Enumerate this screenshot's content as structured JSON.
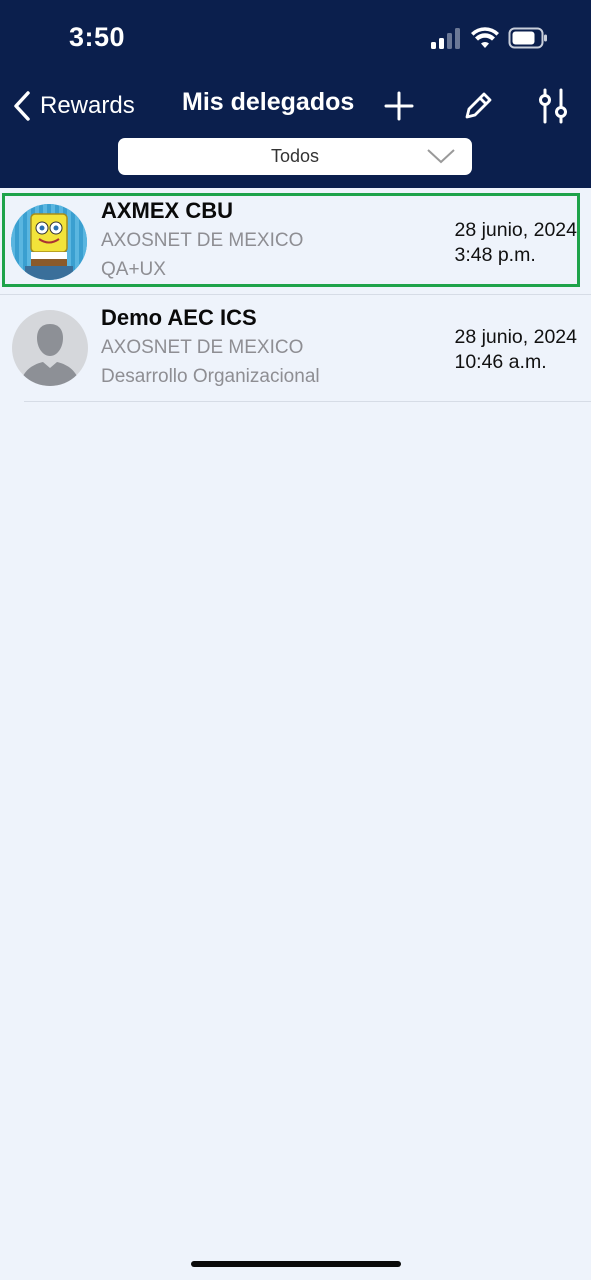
{
  "status_bar": {
    "time": "3:50",
    "icons": [
      "signal-icon",
      "wifi-icon",
      "battery-icon"
    ]
  },
  "nav": {
    "back_label": "Rewards",
    "title": "Mis delegados",
    "actions": [
      "plus-icon",
      "pencil-icon",
      "sliders-icon"
    ]
  },
  "filter": {
    "selected": "Todos"
  },
  "delegates": [
    {
      "name": "AXMEX CBU",
      "company": "AXOSNET DE MEXICO",
      "department": "QA+UX",
      "date": "28 junio, 2024",
      "time": "3:48 p.m.",
      "avatar": "cartoon-avatar",
      "selected": true
    },
    {
      "name": "Demo AEC ICS",
      "company": "AXOSNET DE MEXICO",
      "department": "Desarrollo Organizacional",
      "date": "28 junio, 2024",
      "time": "10:46 a.m.",
      "avatar": "default-person-avatar",
      "selected": false
    }
  ],
  "colors": {
    "header_bg": "#0b1f4d",
    "page_bg": "#eef3fb",
    "selection_border": "#1ea34a",
    "secondary_text": "#8e8e93"
  }
}
